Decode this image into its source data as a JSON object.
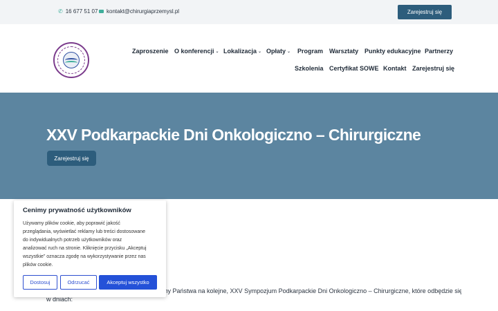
{
  "topbar": {
    "phone": "16 677 51 07",
    "email": "kontakt@chirurgiaprzemysl.pl",
    "register_label": "Zarejestruj się"
  },
  "nav": {
    "items": [
      {
        "label": "Zaproszenie"
      },
      {
        "label": "O konferencji"
      },
      {
        "label": "Lokalizacja"
      },
      {
        "label": "Opłaty"
      },
      {
        "label": "Program"
      },
      {
        "label": "Warsztaty"
      },
      {
        "label": "Punkty edukacyjne"
      },
      {
        "label": "Partnerzy"
      },
      {
        "label": "Szkolenia"
      },
      {
        "label": "Certyfikat SOWE"
      },
      {
        "label": "Kontakt"
      },
      {
        "label": "Zarejestruj się"
      }
    ],
    "dropdown_glyph": "⌄"
  },
  "hero": {
    "title": "XXV Podkarpackie Dni Onkologiczno – Chirurgiczne",
    "register_label": "Zarejestruj się"
  },
  "content": {
    "line1": "amy Państwa na kolejne, XXV Sympozjum Podkarpackie Dni Onkologiczno – Chirurgiczne, które odbędzie się",
    "line2": "w dniach:"
  },
  "cookie": {
    "title": "Cenimy prywatność użytkowników",
    "lines": [
      "Używamy plików cookie, aby poprawić jakość",
      "przeglądania, wyświetlać reklamy lub treści dostosowane",
      "do indywidualnych potrzeb użytkowników oraz",
      "analizować ruch na stronie. Kliknięcie przycisku „Akceptuj",
      "wszystkie” oznacza zgodę na wykorzystywanie przez nas",
      "plików cookie."
    ],
    "customize_label": "Dostosuj",
    "reject_label": "Odrzucać",
    "accept_label": "Akceptuj wszystko"
  },
  "colors": {
    "brand_dark": "#2d5d7c",
    "hero_bg": "#5c85a0",
    "accent_teal": "#3fae9b",
    "cookie_blue": "#2451d8"
  },
  "icons": {
    "phone": "phone-icon",
    "mail": "mail-icon"
  }
}
